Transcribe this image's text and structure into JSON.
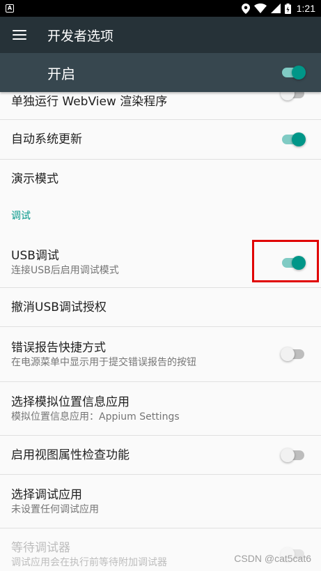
{
  "status_bar": {
    "notification_glyph": "A",
    "time": "1:21"
  },
  "app_bar": {
    "title": "开发者选项"
  },
  "master": {
    "label": "开启",
    "on": true
  },
  "items": {
    "webview": {
      "title": "单独运行 WebView 渲染程序",
      "on": false
    },
    "auto_update": {
      "title": "自动系统更新",
      "on": true
    },
    "demo_mode": {
      "title": "演示模式"
    },
    "debug_category": "调试",
    "usb_debug": {
      "title": "USB调试",
      "subtitle": "连接USB后启用调试模式",
      "on": true
    },
    "revoke_usb": {
      "title": "撤消USB调试授权"
    },
    "bug_report": {
      "title": "错误报告快捷方式",
      "subtitle": "在电源菜单中显示用于提交错误报告的按钮",
      "on": false
    },
    "mock_location": {
      "title": "选择模拟位置信息应用",
      "subtitle": "模拟位置信息应用：Appium Settings"
    },
    "view_attr": {
      "title": "启用视图属性检查功能",
      "on": false
    },
    "debug_app": {
      "title": "选择调试应用",
      "subtitle": "未设置任何调试应用"
    },
    "wait_debugger": {
      "title": "等待调试器",
      "subtitle": "调试应用会在执行前等待附加调试器",
      "on": false
    }
  },
  "watermark": "CSDN @cat5cat6",
  "colors": {
    "accent": "#009688",
    "app_bar": "#263238",
    "master_bar": "#37474f",
    "highlight": "#e00000"
  }
}
